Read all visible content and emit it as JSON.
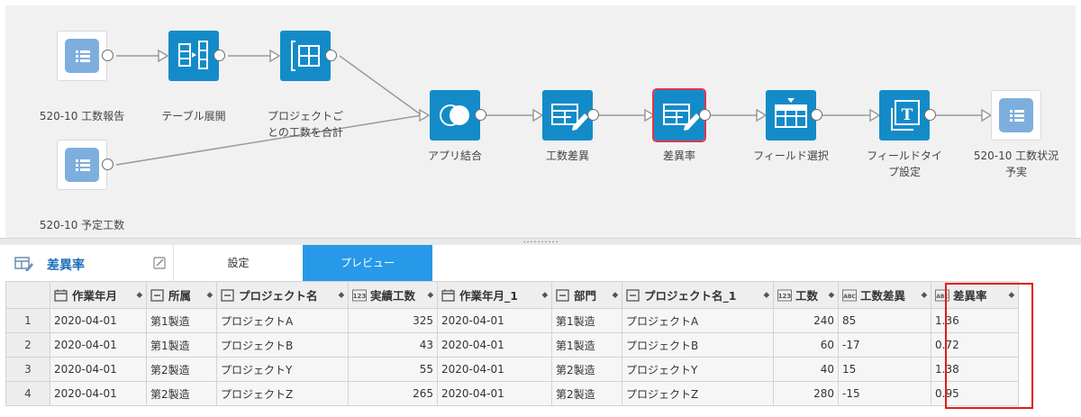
{
  "flow": {
    "nodes": [
      {
        "id": "n1",
        "label": "520-10 工数報告",
        "icon": "list-input-icon"
      },
      {
        "id": "n2",
        "label": "テーブル展開",
        "icon": "table-expand-icon"
      },
      {
        "id": "n3",
        "label": "プロジェクトご\nとの工数を合計",
        "icon": "group-sum-icon"
      },
      {
        "id": "n4",
        "label": "520-10 予定工数",
        "icon": "list-input-icon"
      },
      {
        "id": "n5",
        "label": "アプリ結合",
        "icon": "join-icon"
      },
      {
        "id": "n6",
        "label": "工数差異",
        "icon": "edit-table-icon"
      },
      {
        "id": "n7",
        "label": "差異率",
        "icon": "edit-table-icon"
      },
      {
        "id": "n8",
        "label": "フィールド選択",
        "icon": "field-select-icon"
      },
      {
        "id": "n9",
        "label": "フィールドタイ\nプ設定",
        "icon": "field-type-icon"
      },
      {
        "id": "n10",
        "label": "520-10 工数状況\n予実",
        "icon": "list-output-icon"
      }
    ],
    "selected": "差異率"
  },
  "panel": {
    "title": "差異率",
    "tabs": {
      "settings": "設定",
      "preview": "プレビュー"
    },
    "active_tab": "プレビュー"
  },
  "table": {
    "columns": [
      {
        "name": "作業年月",
        "type": "date-icon"
      },
      {
        "name": "所属",
        "type": "text-icon"
      },
      {
        "name": "プロジェクト名",
        "type": "text-icon"
      },
      {
        "name": "実績工数",
        "type": "number-icon",
        "badge": "123"
      },
      {
        "name": "作業年月_1",
        "type": "date-icon"
      },
      {
        "name": "部門",
        "type": "text-icon"
      },
      {
        "name": "プロジェクト名_1",
        "type": "text-icon"
      },
      {
        "name": "工数",
        "type": "number-icon",
        "badge": "123"
      },
      {
        "name": "工数差異",
        "type": "string-icon",
        "badge": "ABC"
      },
      {
        "name": "差異率",
        "type": "string-icon",
        "badge": "ABC"
      }
    ],
    "sort_glyph": "⬥",
    "rows": [
      {
        "n": "1",
        "cells": [
          "2020-04-01",
          "第1製造",
          "プロジェクトA",
          "325",
          "2020-04-01",
          "第1製造",
          "プロジェクトA",
          "240",
          "85",
          "1.36"
        ]
      },
      {
        "n": "2",
        "cells": [
          "2020-04-01",
          "第1製造",
          "プロジェクトB",
          "43",
          "2020-04-01",
          "第1製造",
          "プロジェクトB",
          "60",
          "-17",
          "0.72"
        ]
      },
      {
        "n": "3",
        "cells": [
          "2020-04-01",
          "第2製造",
          "プロジェクトY",
          "55",
          "2020-04-01",
          "第2製造",
          "プロジェクトY",
          "40",
          "15",
          "1.38"
        ]
      },
      {
        "n": "4",
        "cells": [
          "2020-04-01",
          "第2製造",
          "プロジェクトZ",
          "265",
          "2020-04-01",
          "第2製造",
          "プロジェクトZ",
          "280",
          "-15",
          "0.95"
        ]
      }
    ],
    "highlighted_column": "差異率",
    "highlight_color": "#e01b1b"
  },
  "colors": {
    "tile_blue": "#148bc9",
    "tab_active": "#2799e8",
    "title_blue": "#1c6fb8",
    "selected_border": "#e5344b"
  }
}
